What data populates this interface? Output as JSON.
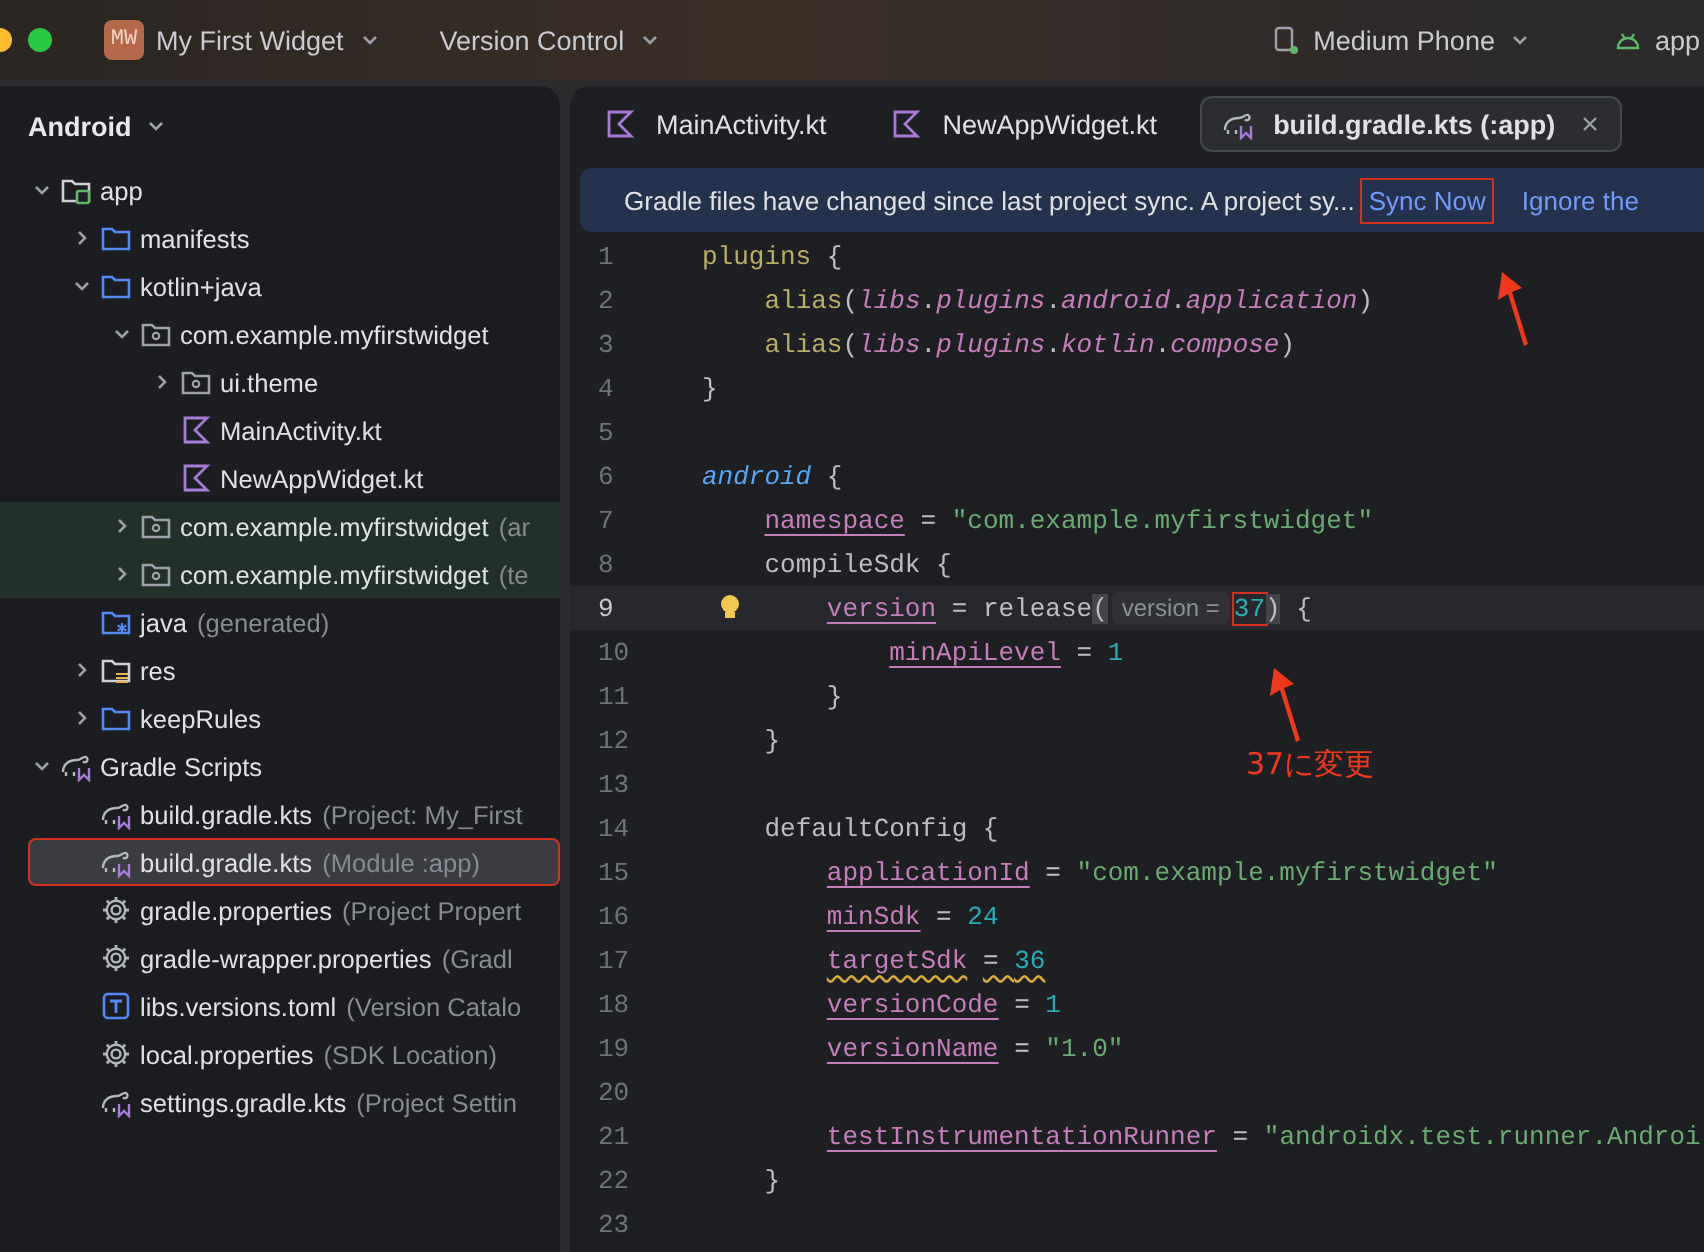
{
  "title_bar": {
    "project_badge": "MW",
    "project": "My First Widget",
    "vcs": "Version Control",
    "device": "Medium Phone",
    "run_config": "app"
  },
  "sidebar": {
    "title": "Android",
    "tree": [
      {
        "label": "app",
        "kind": "module",
        "expanded": true,
        "selected": false,
        "tinted": false,
        "annotated": false,
        "children": [
          {
            "label": "manifests",
            "kind": "folder",
            "expanded": false,
            "selected": false,
            "tinted": false,
            "annotated": false
          },
          {
            "label": "kotlin+java",
            "kind": "folder",
            "expanded": true,
            "selected": false,
            "tinted": false,
            "annotated": false,
            "children": [
              {
                "label": "com.example.myfirstwidget",
                "kind": "package",
                "expanded": true,
                "selected": false,
                "tinted": false,
                "annotated": false,
                "children": [
                  {
                    "label": "ui.theme",
                    "kind": "package",
                    "expanded": false,
                    "selected": false,
                    "tinted": false,
                    "annotated": false
                  },
                  {
                    "label": "MainActivity.kt",
                    "kind": "kotlin",
                    "selected": false,
                    "tinted": false,
                    "annotated": false
                  },
                  {
                    "label": "NewAppWidget.kt",
                    "kind": "kotlin",
                    "selected": false,
                    "tinted": false,
                    "annotated": false
                  }
                ]
              },
              {
                "label": "com.example.myfirstwidget",
                "detail": "(ar",
                "kind": "package",
                "expanded": false,
                "selected": false,
                "tinted": true,
                "annotated": false
              },
              {
                "label": "com.example.myfirstwidget",
                "detail": "(te",
                "kind": "package",
                "expanded": false,
                "selected": false,
                "tinted": true,
                "annotated": false
              }
            ]
          },
          {
            "label": "java",
            "detail": "(generated)",
            "kind": "generated",
            "selected": false,
            "tinted": false,
            "annotated": false
          },
          {
            "label": "res",
            "kind": "res",
            "expanded": false,
            "selected": false,
            "tinted": false,
            "annotated": false
          },
          {
            "label": "keepRules",
            "kind": "folder",
            "expanded": false,
            "selected": false,
            "tinted": false,
            "annotated": false
          }
        ]
      },
      {
        "label": "Gradle Scripts",
        "kind": "gradle",
        "expanded": true,
        "selected": false,
        "tinted": false,
        "annotated": false,
        "children": [
          {
            "label": "build.gradle.kts",
            "detail": "(Project: My_First",
            "kind": "gradle",
            "selected": false,
            "tinted": false,
            "annotated": false
          },
          {
            "label": "build.gradle.kts",
            "detail": "(Module :app)",
            "kind": "gradle",
            "selected": true,
            "tinted": false,
            "annotated": true
          },
          {
            "label": "gradle.properties",
            "detail": "(Project Propert",
            "kind": "gear",
            "selected": false,
            "tinted": false,
            "annotated": false
          },
          {
            "label": "gradle-wrapper.properties",
            "detail": "(Gradl",
            "kind": "gear",
            "selected": false,
            "tinted": false,
            "annotated": false
          },
          {
            "label": "libs.versions.toml",
            "detail": "(Version Catalo",
            "kind": "toml",
            "selected": false,
            "tinted": false,
            "annotated": false
          },
          {
            "label": "local.properties",
            "detail": "(SDK Location)",
            "kind": "gear",
            "selected": false,
            "tinted": false,
            "annotated": false
          },
          {
            "label": "settings.gradle.kts",
            "detail": "(Project Settin",
            "kind": "gradle",
            "selected": false,
            "tinted": false,
            "annotated": false
          }
        ]
      }
    ]
  },
  "editor": {
    "tabs": [
      {
        "label": "MainActivity.kt",
        "kind": "kotlin",
        "selected": false,
        "closable": false
      },
      {
        "label": "NewAppWidget.kt",
        "kind": "kotlin",
        "selected": false,
        "closable": false
      },
      {
        "label": "build.gradle.kts (:app)",
        "kind": "gradle",
        "selected": true,
        "closable": true
      }
    ],
    "banner": {
      "message": "Gradle files have changed since last project sync. A project sy...",
      "actions": [
        {
          "label": "Sync Now",
          "annotated": true
        },
        {
          "label": "Ignore the",
          "annotated": false
        }
      ]
    },
    "lines": [
      {
        "number": "1",
        "current": false,
        "intention": false,
        "tokens": [
          {
            "kind": "kw",
            "text": "plugins"
          },
          {
            "kind": "plain",
            "text": " {"
          }
        ]
      },
      {
        "number": "2",
        "current": false,
        "intention": false,
        "tokens": [
          {
            "kind": "kw",
            "text": "    alias"
          },
          {
            "kind": "plain",
            "text": "("
          },
          {
            "kind": "ital",
            "text": "libs"
          },
          {
            "kind": "plain",
            "text": "."
          },
          {
            "kind": "ital",
            "text": "plugins"
          },
          {
            "kind": "plain",
            "text": "."
          },
          {
            "kind": "ital",
            "text": "android"
          },
          {
            "kind": "plain",
            "text": "."
          },
          {
            "kind": "ital",
            "text": "application"
          },
          {
            "kind": "plain",
            "text": ")"
          }
        ]
      },
      {
        "number": "3",
        "current": false,
        "intention": false,
        "tokens": [
          {
            "kind": "kw",
            "text": "    alias"
          },
          {
            "kind": "plain",
            "text": "("
          },
          {
            "kind": "ital",
            "text": "libs"
          },
          {
            "kind": "plain",
            "text": "."
          },
          {
            "kind": "ital",
            "text": "plugins"
          },
          {
            "kind": "plain",
            "text": "."
          },
          {
            "kind": "ital",
            "text": "kotlin"
          },
          {
            "kind": "plain",
            "text": "."
          },
          {
            "kind": "ital",
            "text": "compose"
          },
          {
            "kind": "plain",
            "text": ")"
          }
        ]
      },
      {
        "number": "4",
        "current": false,
        "intention": false,
        "tokens": [
          {
            "kind": "plain",
            "text": "}"
          }
        ]
      },
      {
        "number": "5",
        "current": false,
        "intention": false
      },
      {
        "number": "6",
        "current": false,
        "intention": false,
        "tokens": [
          {
            "kind": "blue",
            "text": "android"
          },
          {
            "kind": "plain",
            "text": " {"
          }
        ]
      },
      {
        "number": "7",
        "current": false,
        "intention": false,
        "tokens": [
          {
            "kind": "prop",
            "text": "    namespace"
          },
          {
            "kind": "plain",
            "text": " = "
          },
          {
            "kind": "str",
            "text": "\"com.example.myfirstwidget\""
          }
        ]
      },
      {
        "number": "8",
        "current": false,
        "intention": false,
        "tokens": [
          {
            "kind": "plain",
            "text": "    compileSdk {"
          }
        ]
      },
      {
        "number": "9",
        "current": true,
        "intention": true,
        "tokens": [
          {
            "kind": "prop",
            "text": "        version"
          },
          {
            "kind": "plain",
            "text": " = release"
          },
          {
            "kind": "match",
            "text": "("
          },
          {
            "kind": "hint",
            "text": "version ="
          },
          {
            "kind": "num_marked",
            "text": "37"
          },
          {
            "kind": "match",
            "text": ")"
          },
          {
            "kind": "plain",
            "text": " {"
          }
        ]
      },
      {
        "number": "10",
        "current": false,
        "intention": false,
        "tokens": [
          {
            "kind": "prop",
            "text": "            minApiLevel"
          },
          {
            "kind": "plain",
            "text": " = "
          },
          {
            "kind": "num",
            "text": "1"
          }
        ]
      },
      {
        "number": "11",
        "current": false,
        "intention": false,
        "tokens": [
          {
            "kind": "plain",
            "text": "        }"
          }
        ]
      },
      {
        "number": "12",
        "current": false,
        "intention": false,
        "tokens": [
          {
            "kind": "plain",
            "text": "    }"
          }
        ]
      },
      {
        "number": "13",
        "current": false,
        "intention": false
      },
      {
        "number": "14",
        "current": false,
        "intention": false,
        "tokens": [
          {
            "kind": "plain",
            "text": "    defaultConfig {"
          }
        ]
      },
      {
        "number": "15",
        "current": false,
        "intention": false,
        "tokens": [
          {
            "kind": "prop",
            "text": "        applicationId"
          },
          {
            "kind": "plain",
            "text": " = "
          },
          {
            "kind": "str",
            "text": "\"com.example.myfirstwidget\""
          }
        ]
      },
      {
        "number": "16",
        "current": false,
        "intention": false,
        "tokens": [
          {
            "kind": "prop",
            "text": "        minSdk"
          },
          {
            "kind": "plain",
            "text": " = "
          },
          {
            "kind": "num",
            "text": "24"
          }
        ]
      },
      {
        "number": "17",
        "current": false,
        "intention": false,
        "tokens": [
          {
            "kind": "prop_warn",
            "text": "        targetSdk"
          },
          {
            "kind": "plain_warn",
            "text": " = "
          },
          {
            "kind": "num_warn",
            "text": "36"
          }
        ]
      },
      {
        "number": "18",
        "current": false,
        "intention": false,
        "tokens": [
          {
            "kind": "prop",
            "text": "        versionCode"
          },
          {
            "kind": "plain",
            "text": " = "
          },
          {
            "kind": "num",
            "text": "1"
          }
        ]
      },
      {
        "number": "19",
        "current": false,
        "intention": false,
        "tokens": [
          {
            "kind": "prop",
            "text": "        versionName"
          },
          {
            "kind": "plain",
            "text": " = "
          },
          {
            "kind": "str",
            "text": "\"1.0\""
          }
        ]
      },
      {
        "number": "20",
        "current": false,
        "intention": false
      },
      {
        "number": "21",
        "current": false,
        "intention": false,
        "tokens": [
          {
            "kind": "prop",
            "text": "        testInstrumentationRunner"
          },
          {
            "kind": "plain",
            "text": " = "
          },
          {
            "kind": "str",
            "text": "\"androidx.test.runner.Androi"
          }
        ]
      },
      {
        "number": "22",
        "current": false,
        "intention": false,
        "tokens": [
          {
            "kind": "plain",
            "text": "    }"
          }
        ]
      },
      {
        "number": "23",
        "current": false,
        "intention": false
      }
    ],
    "annotation_note": "37に変更"
  }
}
